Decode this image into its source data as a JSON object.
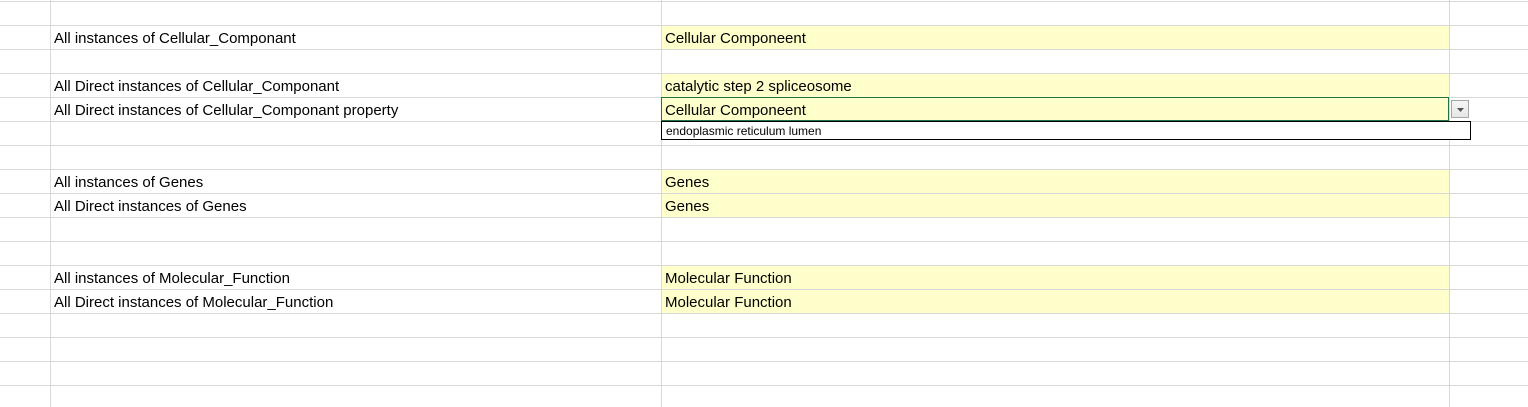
{
  "rows": [
    {
      "label": "All instances of Cellular_Componant",
      "value": "Cellular Componeent"
    },
    {
      "label": "All Direct instances of Cellular_Componant",
      "value": "catalytic step 2 spliceosome"
    },
    {
      "label": "All Direct instances of Cellular_Componant property",
      "value": "Cellular Componeent"
    },
    {
      "label": "All instances of Genes",
      "value": "Genes"
    },
    {
      "label": "All Direct instances of Genes",
      "value": "Genes"
    },
    {
      "label": "All instances of Molecular_Function",
      "value": "Molecular Function"
    },
    {
      "label": "All Direct instances of Molecular_Function",
      "value": "Molecular Function"
    }
  ],
  "dropdown": {
    "options": [
      "endoplasmic reticulum lumen"
    ]
  },
  "colors": {
    "cell_fill": "#ffffcc",
    "gridline": "#d9d9d9",
    "active_cell_border": "#217346"
  },
  "icons": {
    "dropdown": "chevron-down-icon"
  }
}
